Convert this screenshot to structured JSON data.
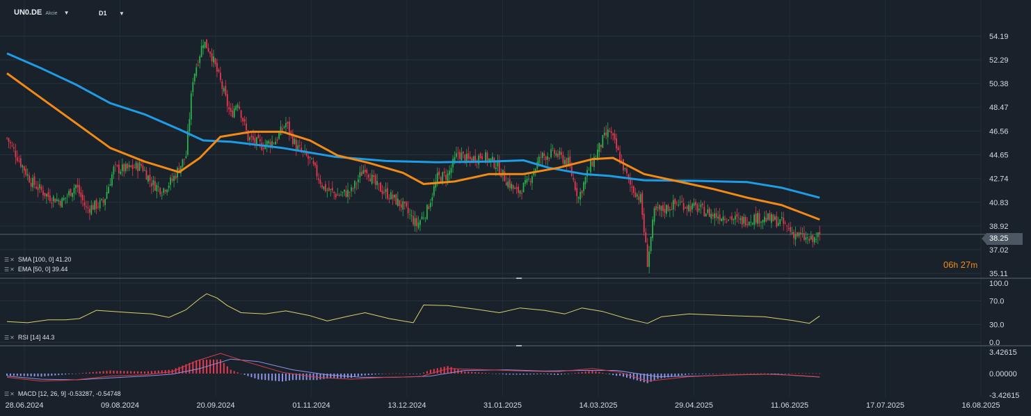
{
  "header": {
    "symbol": "UN0.DE",
    "instrument_type": "Akcie",
    "timeframe": "D1"
  },
  "price_badge": "38.25",
  "countdown": {
    "hours": "06",
    "h_unit": "h",
    "minutes": "27",
    "m_unit": "m"
  },
  "legends": {
    "sma": "SMA [100, 0] 41.20",
    "ema": "EMA [50, 0] 39.44",
    "rsi": "RSI [14] 44.3",
    "macd": "MACD [12, 26, 9] -0.53287, -0.54748"
  },
  "colors": {
    "background": "#19222b",
    "up_candle": "#29b34d",
    "down_candle": "#e8384f",
    "sma": "#1e9ce6",
    "ema": "#f38a16",
    "rsi": "#d9d16b",
    "macd_line": "#d93a47",
    "signal_line": "#8f93e8",
    "hist_pos": "#e8384f",
    "hist_neg": "#8f93e8",
    "countdown": "#f08c1a"
  },
  "chart_data": [
    {
      "type": "candlestick",
      "x": [
        "28.06.2024",
        "09.08.2024",
        "20.09.2024",
        "01.11.2024",
        "13.12.2024",
        "31.01.2025",
        "14.03.2025",
        "29.04.2025",
        "11.06.2025",
        "17.07.2025",
        "16.08.2025"
      ],
      "y_ticks": [
        "54.19",
        "52.29",
        "50.38",
        "48.47",
        "46.56",
        "44.65",
        "42.74",
        "40.83",
        "38.92",
        "37.02",
        "35.11"
      ],
      "ylim": [
        35.11,
        55.2
      ],
      "last_price": 38.25,
      "close_path": [
        {
          "d": 0,
          "c": 46.0
        },
        {
          "d": 6,
          "c": 44.5
        },
        {
          "d": 14,
          "c": 42.5
        },
        {
          "d": 24,
          "c": 41.3
        },
        {
          "d": 32,
          "c": 40.9
        },
        {
          "d": 40,
          "c": 42.2
        },
        {
          "d": 46,
          "c": 40.3
        },
        {
          "d": 56,
          "c": 40.8
        },
        {
          "d": 62,
          "c": 43.5
        },
        {
          "d": 70,
          "c": 43.5
        },
        {
          "d": 78,
          "c": 43.8
        },
        {
          "d": 84,
          "c": 42.4
        },
        {
          "d": 90,
          "c": 41.8
        },
        {
          "d": 96,
          "c": 42.6
        },
        {
          "d": 104,
          "c": 44.6
        },
        {
          "d": 108,
          "c": 50.8
        },
        {
          "d": 114,
          "c": 53.8
        },
        {
          "d": 118,
          "c": 53.0
        },
        {
          "d": 124,
          "c": 50.5
        },
        {
          "d": 130,
          "c": 47.8
        },
        {
          "d": 134,
          "c": 49.0
        },
        {
          "d": 140,
          "c": 46.0
        },
        {
          "d": 148,
          "c": 45.4
        },
        {
          "d": 156,
          "c": 45.8
        },
        {
          "d": 162,
          "c": 47.2
        },
        {
          "d": 168,
          "c": 45.3
        },
        {
          "d": 176,
          "c": 44.2
        },
        {
          "d": 184,
          "c": 42.0
        },
        {
          "d": 192,
          "c": 41.4
        },
        {
          "d": 200,
          "c": 41.7
        },
        {
          "d": 208,
          "c": 43.7
        },
        {
          "d": 214,
          "c": 42.2
        },
        {
          "d": 222,
          "c": 41.4
        },
        {
          "d": 230,
          "c": 40.5
        },
        {
          "d": 238,
          "c": 39.0
        },
        {
          "d": 244,
          "c": 40.2
        },
        {
          "d": 250,
          "c": 42.8
        },
        {
          "d": 256,
          "c": 43.0
        },
        {
          "d": 262,
          "c": 44.8
        },
        {
          "d": 268,
          "c": 44.2
        },
        {
          "d": 276,
          "c": 44.6
        },
        {
          "d": 284,
          "c": 43.9
        },
        {
          "d": 290,
          "c": 42.6
        },
        {
          "d": 296,
          "c": 41.6
        },
        {
          "d": 302,
          "c": 42.3
        },
        {
          "d": 310,
          "c": 44.5
        },
        {
          "d": 318,
          "c": 44.8
        },
        {
          "d": 326,
          "c": 44.0
        },
        {
          "d": 332,
          "c": 41.2
        },
        {
          "d": 338,
          "c": 43.5
        },
        {
          "d": 346,
          "c": 45.8
        },
        {
          "d": 350,
          "c": 46.6
        },
        {
          "d": 356,
          "c": 44.4
        },
        {
          "d": 362,
          "c": 42.2
        },
        {
          "d": 368,
          "c": 41.1
        },
        {
          "d": 372,
          "c": 36.0
        },
        {
          "d": 376,
          "c": 40.0
        },
        {
          "d": 382,
          "c": 40.3
        },
        {
          "d": 390,
          "c": 40.8
        },
        {
          "d": 396,
          "c": 40.5
        },
        {
          "d": 402,
          "c": 40.3
        },
        {
          "d": 410,
          "c": 39.8
        },
        {
          "d": 418,
          "c": 39.7
        },
        {
          "d": 426,
          "c": 39.3
        },
        {
          "d": 434,
          "c": 39.6
        },
        {
          "d": 442,
          "c": 39.5
        },
        {
          "d": 450,
          "c": 39.2
        },
        {
          "d": 456,
          "c": 38.4
        },
        {
          "d": 462,
          "c": 38.0
        },
        {
          "d": 468,
          "c": 37.7
        },
        {
          "d": 472,
          "c": 38.25
        }
      ],
      "sma": [
        {
          "d": 0,
          "v": 52.8
        },
        {
          "d": 20,
          "v": 51.6
        },
        {
          "d": 40,
          "v": 50.3
        },
        {
          "d": 60,
          "v": 48.8
        },
        {
          "d": 80,
          "v": 47.9
        },
        {
          "d": 100,
          "v": 46.7
        },
        {
          "d": 114,
          "v": 45.8
        },
        {
          "d": 130,
          "v": 45.7
        },
        {
          "d": 160,
          "v": 45.2
        },
        {
          "d": 190,
          "v": 44.5
        },
        {
          "d": 220,
          "v": 44.15
        },
        {
          "d": 250,
          "v": 44.05
        },
        {
          "d": 280,
          "v": 44.1
        },
        {
          "d": 300,
          "v": 44.2
        },
        {
          "d": 315,
          "v": 43.6
        },
        {
          "d": 335,
          "v": 43.1
        },
        {
          "d": 350,
          "v": 42.95
        },
        {
          "d": 370,
          "v": 42.6
        },
        {
          "d": 400,
          "v": 42.55
        },
        {
          "d": 430,
          "v": 42.45
        },
        {
          "d": 450,
          "v": 42.0
        },
        {
          "d": 472,
          "v": 41.2
        }
      ],
      "ema": [
        {
          "d": 0,
          "v": 51.2
        },
        {
          "d": 20,
          "v": 49.2
        },
        {
          "d": 40,
          "v": 47.2
        },
        {
          "d": 60,
          "v": 45.2
        },
        {
          "d": 80,
          "v": 44.1
        },
        {
          "d": 100,
          "v": 43.25
        },
        {
          "d": 112,
          "v": 44.4
        },
        {
          "d": 124,
          "v": 46.1
        },
        {
          "d": 142,
          "v": 46.5
        },
        {
          "d": 160,
          "v": 46.5
        },
        {
          "d": 176,
          "v": 45.8
        },
        {
          "d": 192,
          "v": 44.6
        },
        {
          "d": 210,
          "v": 44.0
        },
        {
          "d": 230,
          "v": 43.2
        },
        {
          "d": 242,
          "v": 42.3
        },
        {
          "d": 260,
          "v": 42.5
        },
        {
          "d": 280,
          "v": 43.1
        },
        {
          "d": 300,
          "v": 43.1
        },
        {
          "d": 320,
          "v": 43.6
        },
        {
          "d": 340,
          "v": 44.3
        },
        {
          "d": 352,
          "v": 44.4
        },
        {
          "d": 370,
          "v": 43.1
        },
        {
          "d": 390,
          "v": 42.5
        },
        {
          "d": 410,
          "v": 41.9
        },
        {
          "d": 430,
          "v": 41.2
        },
        {
          "d": 450,
          "v": 40.6
        },
        {
          "d": 472,
          "v": 39.44
        }
      ]
    },
    {
      "type": "line",
      "name": "RSI [14]",
      "y_ticks": [
        "100.0",
        "70.0",
        "30.0",
        "0.0"
      ],
      "ylim": [
        0,
        100
      ],
      "last": 44.3,
      "path": [
        {
          "d": 0,
          "v": 35
        },
        {
          "d": 12,
          "v": 33
        },
        {
          "d": 24,
          "v": 38
        },
        {
          "d": 34,
          "v": 38
        },
        {
          "d": 42,
          "v": 40
        },
        {
          "d": 52,
          "v": 54
        },
        {
          "d": 62,
          "v": 52
        },
        {
          "d": 72,
          "v": 50
        },
        {
          "d": 84,
          "v": 48
        },
        {
          "d": 94,
          "v": 42
        },
        {
          "d": 104,
          "v": 55
        },
        {
          "d": 112,
          "v": 74
        },
        {
          "d": 116,
          "v": 82
        },
        {
          "d": 122,
          "v": 75
        },
        {
          "d": 128,
          "v": 62
        },
        {
          "d": 136,
          "v": 50
        },
        {
          "d": 150,
          "v": 48
        },
        {
          "d": 162,
          "v": 53
        },
        {
          "d": 176,
          "v": 45
        },
        {
          "d": 186,
          "v": 36
        },
        {
          "d": 198,
          "v": 44
        },
        {
          "d": 208,
          "v": 50
        },
        {
          "d": 222,
          "v": 40
        },
        {
          "d": 236,
          "v": 33
        },
        {
          "d": 242,
          "v": 63
        },
        {
          "d": 256,
          "v": 62
        },
        {
          "d": 272,
          "v": 56
        },
        {
          "d": 286,
          "v": 50
        },
        {
          "d": 298,
          "v": 58
        },
        {
          "d": 312,
          "v": 54
        },
        {
          "d": 324,
          "v": 48
        },
        {
          "d": 334,
          "v": 58
        },
        {
          "d": 346,
          "v": 52
        },
        {
          "d": 360,
          "v": 40
        },
        {
          "d": 372,
          "v": 32
        },
        {
          "d": 380,
          "v": 43
        },
        {
          "d": 396,
          "v": 48
        },
        {
          "d": 420,
          "v": 45
        },
        {
          "d": 440,
          "v": 43
        },
        {
          "d": 456,
          "v": 37
        },
        {
          "d": 466,
          "v": 32
        },
        {
          "d": 472,
          "v": 44.3
        }
      ]
    },
    {
      "type": "bar",
      "name": "MACD [12, 26, 9]",
      "y_ticks": [
        "3.42615",
        "0.00000",
        "-3.42615"
      ],
      "ylim": [
        -3.42615,
        3.42615
      ],
      "macd_last": -0.53287,
      "signal_last": -0.54748,
      "macd": [
        {
          "d": 0,
          "v": -0.6
        },
        {
          "d": 20,
          "v": -1.2
        },
        {
          "d": 40,
          "v": -1.0
        },
        {
          "d": 60,
          "v": -0.4
        },
        {
          "d": 80,
          "v": -0.2
        },
        {
          "d": 96,
          "v": 0.3
        },
        {
          "d": 110,
          "v": 2.0
        },
        {
          "d": 124,
          "v": 3.2
        },
        {
          "d": 140,
          "v": 1.8
        },
        {
          "d": 160,
          "v": 0.2
        },
        {
          "d": 180,
          "v": -0.6
        },
        {
          "d": 200,
          "v": -0.9
        },
        {
          "d": 220,
          "v": -0.6
        },
        {
          "d": 240,
          "v": -0.5
        },
        {
          "d": 256,
          "v": 0.8
        },
        {
          "d": 280,
          "v": 0.6
        },
        {
          "d": 300,
          "v": 0.4
        },
        {
          "d": 320,
          "v": 0.3
        },
        {
          "d": 340,
          "v": 0.8
        },
        {
          "d": 356,
          "v": 0.2
        },
        {
          "d": 372,
          "v": -1.2
        },
        {
          "d": 396,
          "v": -0.5
        },
        {
          "d": 420,
          "v": -0.2
        },
        {
          "d": 440,
          "v": -0.1
        },
        {
          "d": 460,
          "v": -0.3
        },
        {
          "d": 472,
          "v": -0.53
        }
      ],
      "signal": [
        {
          "d": 0,
          "v": -0.4
        },
        {
          "d": 20,
          "v": -0.9
        },
        {
          "d": 40,
          "v": -1.0
        },
        {
          "d": 60,
          "v": -0.7
        },
        {
          "d": 80,
          "v": -0.4
        },
        {
          "d": 96,
          "v": -0.1
        },
        {
          "d": 112,
          "v": 0.8
        },
        {
          "d": 130,
          "v": 2.3
        },
        {
          "d": 146,
          "v": 1.9
        },
        {
          "d": 166,
          "v": 0.6
        },
        {
          "d": 186,
          "v": -0.2
        },
        {
          "d": 206,
          "v": -0.6
        },
        {
          "d": 226,
          "v": -0.6
        },
        {
          "d": 246,
          "v": -0.4
        },
        {
          "d": 266,
          "v": 0.5
        },
        {
          "d": 290,
          "v": 0.6
        },
        {
          "d": 312,
          "v": 0.4
        },
        {
          "d": 334,
          "v": 0.5
        },
        {
          "d": 354,
          "v": 0.5
        },
        {
          "d": 378,
          "v": -0.5
        },
        {
          "d": 400,
          "v": -0.4
        },
        {
          "d": 424,
          "v": -0.2
        },
        {
          "d": 446,
          "v": -0.1
        },
        {
          "d": 472,
          "v": -0.55
        }
      ]
    }
  ]
}
